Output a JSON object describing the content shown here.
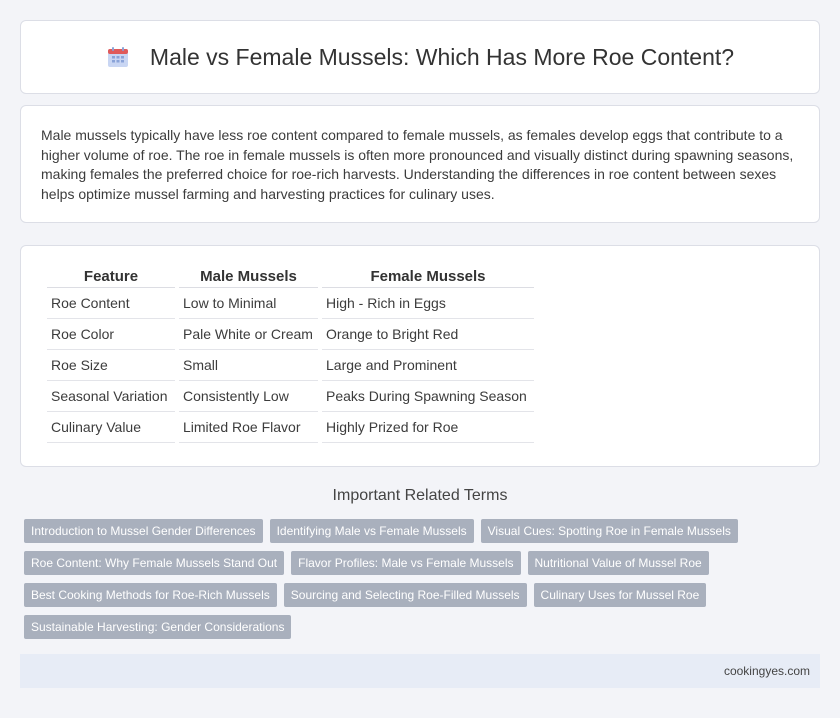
{
  "header": {
    "title": "Male vs Female Mussels: Which Has More Roe Content?",
    "icon": "calendar-icon",
    "icon_colors": {
      "top": "#e05a5a",
      "body": "#c9d6f3",
      "dots": "#8aa3d8"
    }
  },
  "intro": {
    "text": "Male mussels typically have less roe content compared to female mussels, as females develop eggs that contribute to a higher volume of roe. The roe in female mussels is often more pronounced and visually distinct during spawning seasons, making females the preferred choice for roe-rich harvests. Understanding the differences in roe content between sexes helps optimize mussel farming and harvesting practices for culinary uses."
  },
  "table": {
    "headers": [
      "Feature",
      "Male Mussels",
      "Female Mussels"
    ],
    "rows": [
      [
        "Roe Content",
        "Low to Minimal",
        "High - Rich in Eggs"
      ],
      [
        "Roe Color",
        "Pale White or Cream",
        "Orange to Bright Red"
      ],
      [
        "Roe Size",
        "Small",
        "Large and Prominent"
      ],
      [
        "Seasonal Variation",
        "Consistently Low",
        "Peaks During Spawning Season"
      ],
      [
        "Culinary Value",
        "Limited Roe Flavor",
        "Highly Prized for Roe"
      ]
    ]
  },
  "related": {
    "title": "Important Related Terms",
    "rows": [
      [
        "Introduction to Mussel Gender Differences",
        "Identifying Male vs Female Mussels",
        "Visual Cues: Spotting Roe in Female Mussels"
      ],
      [
        "Roe Content: Why Female Mussels Stand Out",
        "Flavor Profiles: Male vs Female Mussels",
        "Nutritional Value of Mussel Roe"
      ],
      [
        "Best Cooking Methods for Roe-Rich Mussels",
        "Sourcing and Selecting Roe-Filled Mussels",
        "Culinary Uses for Mussel Roe"
      ],
      [
        "Sustainable Harvesting: Gender Considerations"
      ]
    ]
  },
  "footer": {
    "site": "cookingyes.com"
  },
  "colors": {
    "tag_bg": "#a9b0bd",
    "footer_bg": "#e7ecf6"
  }
}
